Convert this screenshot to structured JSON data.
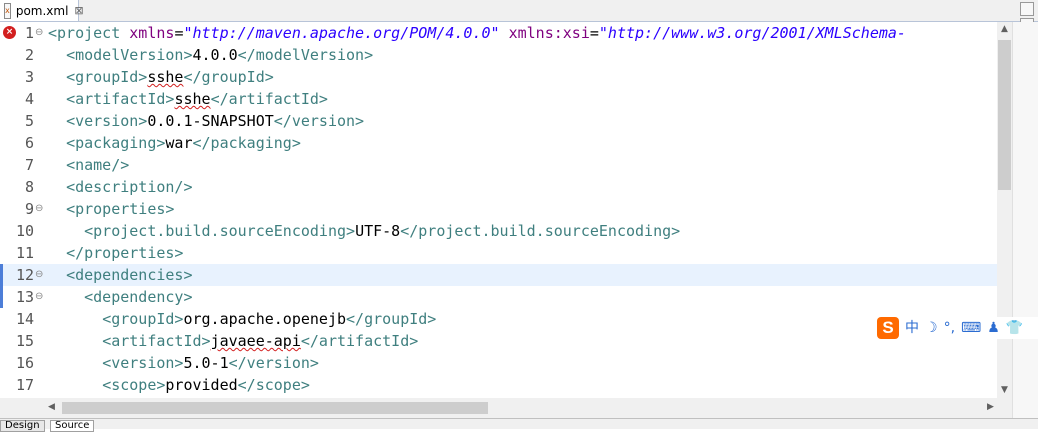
{
  "tab": {
    "label": "pom.xml",
    "close": "⊠"
  },
  "editor": {
    "lines": [
      {
        "num": "1",
        "fold": true,
        "error": true,
        "parts": [
          [
            "tag",
            "<project "
          ],
          [
            "attr",
            "xmlns"
          ],
          [
            "txt",
            "="
          ],
          [
            "val",
            "\"http://maven.apache.org/POM/4.0.0\""
          ],
          [
            "txt",
            " "
          ],
          [
            "attr",
            "xmlns:xsi"
          ],
          [
            "txt",
            "="
          ],
          [
            "val",
            "\"http://www.w3.org/2001/XMLSchema-"
          ]
        ]
      },
      {
        "num": "2",
        "parts": [
          [
            "txt",
            "  "
          ],
          [
            "tag",
            "<modelVersion>"
          ],
          [
            "txt",
            "4.0.0"
          ],
          [
            "tag",
            "</modelVersion>"
          ]
        ]
      },
      {
        "num": "3",
        "parts": [
          [
            "txt",
            "  "
          ],
          [
            "tag",
            "<groupId>"
          ],
          [
            "sq",
            "sshe"
          ],
          [
            "tag",
            "</groupId>"
          ]
        ]
      },
      {
        "num": "4",
        "parts": [
          [
            "txt",
            "  "
          ],
          [
            "tag",
            "<artifactId>"
          ],
          [
            "sq",
            "sshe"
          ],
          [
            "tag",
            "</artifactId>"
          ]
        ]
      },
      {
        "num": "5",
        "parts": [
          [
            "txt",
            "  "
          ],
          [
            "tag",
            "<version>"
          ],
          [
            "txt",
            "0.0.1-SNAPSHOT"
          ],
          [
            "tag",
            "</version>"
          ]
        ]
      },
      {
        "num": "6",
        "parts": [
          [
            "txt",
            "  "
          ],
          [
            "tag",
            "<packaging>"
          ],
          [
            "txt",
            "war"
          ],
          [
            "tag",
            "</packaging>"
          ]
        ]
      },
      {
        "num": "7",
        "parts": [
          [
            "txt",
            "  "
          ],
          [
            "tag",
            "<name/>"
          ]
        ]
      },
      {
        "num": "8",
        "parts": [
          [
            "txt",
            "  "
          ],
          [
            "tag",
            "<description/>"
          ]
        ]
      },
      {
        "num": "9",
        "fold": true,
        "parts": [
          [
            "txt",
            "  "
          ],
          [
            "tag",
            "<properties>"
          ]
        ]
      },
      {
        "num": "10",
        "parts": [
          [
            "txt",
            "    "
          ],
          [
            "tag",
            "<project.build.sourceEncoding>"
          ],
          [
            "txt",
            "UTF-8"
          ],
          [
            "tag",
            "</project.build.sourceEncoding>"
          ]
        ]
      },
      {
        "num": "11",
        "parts": [
          [
            "txt",
            "  "
          ],
          [
            "tag",
            "</properties>"
          ]
        ]
      },
      {
        "num": "12",
        "fold": true,
        "current": true,
        "marker": true,
        "parts": [
          [
            "txt",
            "  "
          ],
          [
            "tag",
            "<dependencies>"
          ]
        ]
      },
      {
        "num": "13",
        "fold": true,
        "marker": true,
        "parts": [
          [
            "txt",
            "    "
          ],
          [
            "tag",
            "<dependency>"
          ]
        ]
      },
      {
        "num": "14",
        "parts": [
          [
            "txt",
            "      "
          ],
          [
            "tag",
            "<groupId>"
          ],
          [
            "txt",
            "org.apache.openejb"
          ],
          [
            "tag",
            "</groupId>"
          ]
        ]
      },
      {
        "num": "15",
        "parts": [
          [
            "txt",
            "      "
          ],
          [
            "tag",
            "<artifactId>"
          ],
          [
            "sq",
            "javaee-api"
          ],
          [
            "tag",
            "</artifactId>"
          ]
        ]
      },
      {
        "num": "16",
        "parts": [
          [
            "txt",
            "      "
          ],
          [
            "tag",
            "<version>"
          ],
          [
            "txt",
            "5.0-1"
          ],
          [
            "tag",
            "</version>"
          ]
        ]
      },
      {
        "num": "17",
        "parts": [
          [
            "txt",
            "      "
          ],
          [
            "tag",
            "<scope>"
          ],
          [
            "txt",
            "provided"
          ],
          [
            "tag",
            "</scope>"
          ]
        ]
      }
    ]
  },
  "bottom_tabs": [
    "Design",
    "Source"
  ],
  "ime": {
    "logo": "S",
    "lang": "中",
    "items": [
      "☽",
      "°,",
      "⌨",
      "♟",
      "👕"
    ]
  },
  "colors": {
    "tag": "#3f7f7f",
    "attr": "#7f007f",
    "value": "#2a00ff",
    "current_line": "#e8f2fe"
  }
}
